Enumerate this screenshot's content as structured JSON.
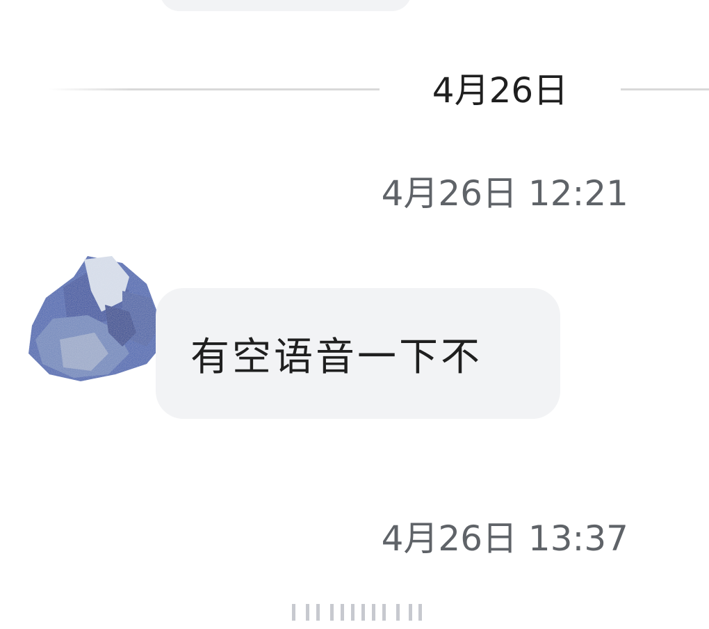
{
  "date_divider": {
    "label": "4月26日"
  },
  "messages": [
    {
      "timestamp": "4月26日 12:21",
      "sender": "avatar",
      "text": "有空语音一下不"
    }
  ],
  "next_timestamp": "4月26日 13:37",
  "colors": {
    "bubble_bg": "#f2f3f5",
    "timestamp_text": "#5f6368",
    "divider_line": "#d9d9d9",
    "avatar_blue": "#3a5aa8"
  }
}
